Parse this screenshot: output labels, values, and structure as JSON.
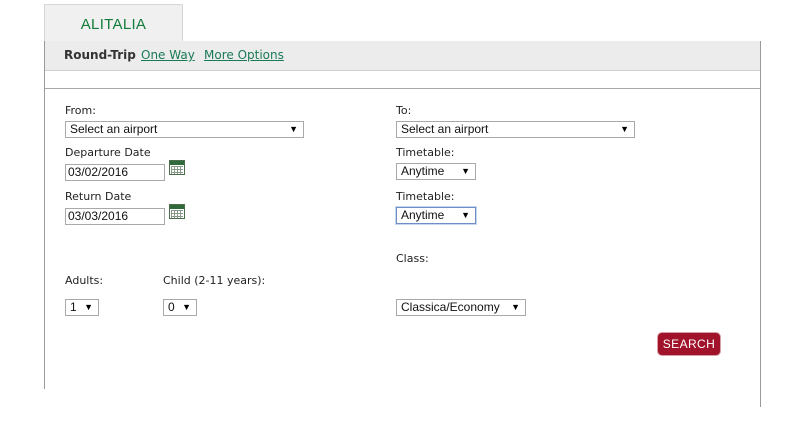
{
  "tab": {
    "label": "ALITALIA"
  },
  "trip_types": {
    "round_trip": "Round-Trip",
    "one_way": "One Way",
    "more_options": "More Options"
  },
  "form": {
    "from": {
      "label": "From:",
      "value": "Select an airport"
    },
    "to": {
      "label": "To:",
      "value": "Select an airport"
    },
    "departure": {
      "label": "Departure Date",
      "value": "03/02/2016"
    },
    "departure_timetable": {
      "label": "Timetable:",
      "value": "Anytime"
    },
    "return": {
      "label": "Return Date",
      "value": "03/03/2016"
    },
    "return_timetable": {
      "label": "Timetable:",
      "value": "Anytime"
    },
    "class": {
      "label": "Class:",
      "value": "Classica/Economy"
    },
    "adults": {
      "label": "Adults:",
      "value": "1"
    },
    "child": {
      "label": "Child (2-11 years):",
      "value": "0"
    },
    "search_label": "SEARCH"
  },
  "icons": {
    "dropdown": "caret-down-icon",
    "calendar": "calendar-icon"
  },
  "colors": {
    "brand_green": "#127c3a",
    "link_green": "#1a7a55",
    "search_red": "#a1132a"
  }
}
